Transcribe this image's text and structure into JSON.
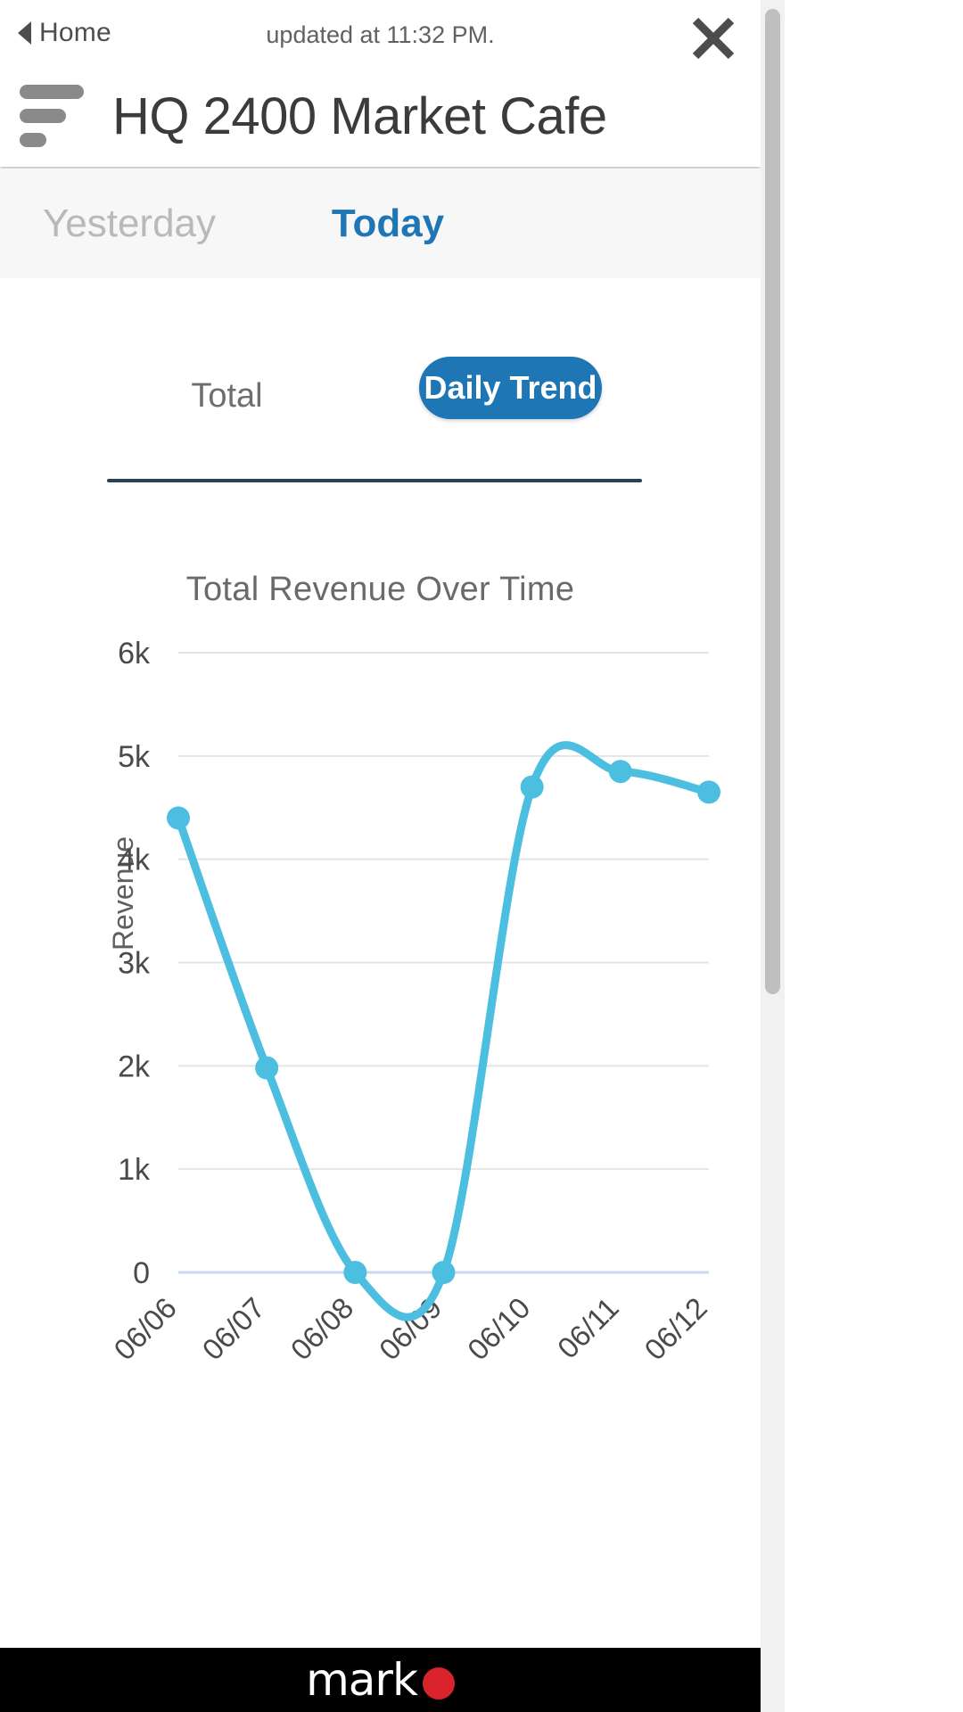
{
  "header": {
    "home_label": "Home",
    "updated_text": "updated at 11:32 PM.",
    "page_title": "HQ 2400 Market Cafe",
    "close_label": "×"
  },
  "day_tabs": [
    {
      "label": "Yesterday",
      "active": false
    },
    {
      "label": "Today",
      "active": true
    }
  ],
  "view_toggle": [
    {
      "label": "Total",
      "active": false
    },
    {
      "label": "Daily Trend",
      "active": true
    }
  ],
  "brand": {
    "word": "mark",
    "dot_color": "#d8232a"
  },
  "colors": {
    "accent_blue": "#1f76b4",
    "line_cyan": "#4cbfe0",
    "divider": "#2b4256",
    "tab_inactive": "#b9b9b9",
    "grid": "#e4e4e4"
  },
  "chart_data": {
    "type": "line",
    "title": "Total Revenue Over Time",
    "xlabel": "",
    "ylabel": "Revenue",
    "categories": [
      "06/06",
      "06/07",
      "06/08",
      "06/09",
      "06/10",
      "06/11",
      "06/12"
    ],
    "values": [
      4400,
      1980,
      0,
      0,
      4700,
      4850,
      4650
    ],
    "ytick_labels": [
      "6k",
      "5k",
      "4k",
      "3k",
      "2k",
      "1k",
      "0"
    ],
    "ytick_values": [
      6000,
      5000,
      4000,
      3000,
      2000,
      1000,
      0
    ],
    "ylim": [
      0,
      6000
    ],
    "grid": true,
    "legend": "none",
    "series": [
      {
        "name": "Revenue",
        "values": [
          4400,
          1980,
          0,
          0,
          4700,
          4850,
          4650
        ],
        "color": "#4cbfe0"
      }
    ]
  }
}
